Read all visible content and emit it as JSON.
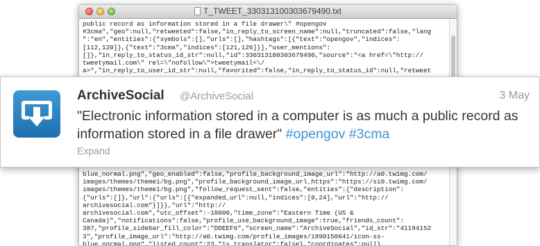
{
  "editor": {
    "title": "T_TWEET_330313100303679490.txt",
    "lines_top": [
      "public record as information stored in a file drawer\\\" #opengov",
      "#3cma\",\"geo\":null,\"retweeted\":false,\"in_reply_to_screen_name\":null,\"truncated\":false,\"lang",
      "\":\"en\",\"entities\":{\"symbols\":[],\"urls\":[],\"hashtags\":[{\"text\":\"opengov\",\"indices\":",
      "[112,120]},{\"text\":\"3cma\",\"indices\":[121,126]}],\"user_mentions\":",
      "[]},\"in_reply_to_status_id_str\":null,\"id\":330313100303679490,\"source\":\"<a href=\\\"http://",
      "tweetymail.com\\\" rel=\\\"nofollow\\\">tweetymail<\\/",
      "a>\",\"in_reply_to_user_id_str\":null,\"favorited\":false,\"in_reply_to_status_id\":null,\"retweet"
    ],
    "lines_bottom": [
      "blue_normal.png\",\"geo_enabled\":false,\"profile_background_image_url\":\"http://a0.twimg.com/",
      "images/themes/theme1/bg.png\",\"profile_background_image_url_https\":\"https://si0.twimg.com/",
      "images/themes/theme1/bg.png\",\"follow_request_sent\":false,\"entities\":{\"description\":",
      "{\"urls\":[]},\"url\":{\"urls\":[{\"expanded_url\":null,\"indices\":[0,24],\"url\":\"http://",
      "archivesocial.com\"}]}},\"url\":\"http://",
      "archivesocial.com\",\"utc_offset\":-18000,\"time_zone\":\"Eastern Time (US &",
      "Canada)\",\"notifications\":false,\"profile_use_background_image\":true,\"friends_count\":",
      "387,\"profile_sidebar_fill_color\":\"DDEEF6\",\"screen_name\":\"ArchiveSocial\",\"id_str\":\"41194152",
      "3\",\"profile_image_url\":\"http://a0.twimg.com/profile_images/1890150641/icon-ss-",
      "blue_normal.png\",\"listed_count\":23,\"is_translator\":false},\"coordinates\":null}"
    ]
  },
  "tweet": {
    "name": "ArchiveSocial",
    "handle": "@ArchiveSocial",
    "date": "3 May",
    "text": "\"Electronic information stored in a computer is as much a public record as information stored in a file drawer\"",
    "hashtags": [
      "#opengov",
      "#3cma"
    ],
    "expand_label": "Expand",
    "avatar_icon": "archive-download-icon"
  },
  "colors": {
    "hashtag": "#3a93d3",
    "avatar_blue": "#2a82c4",
    "muted_text": "#9a9a9a"
  }
}
